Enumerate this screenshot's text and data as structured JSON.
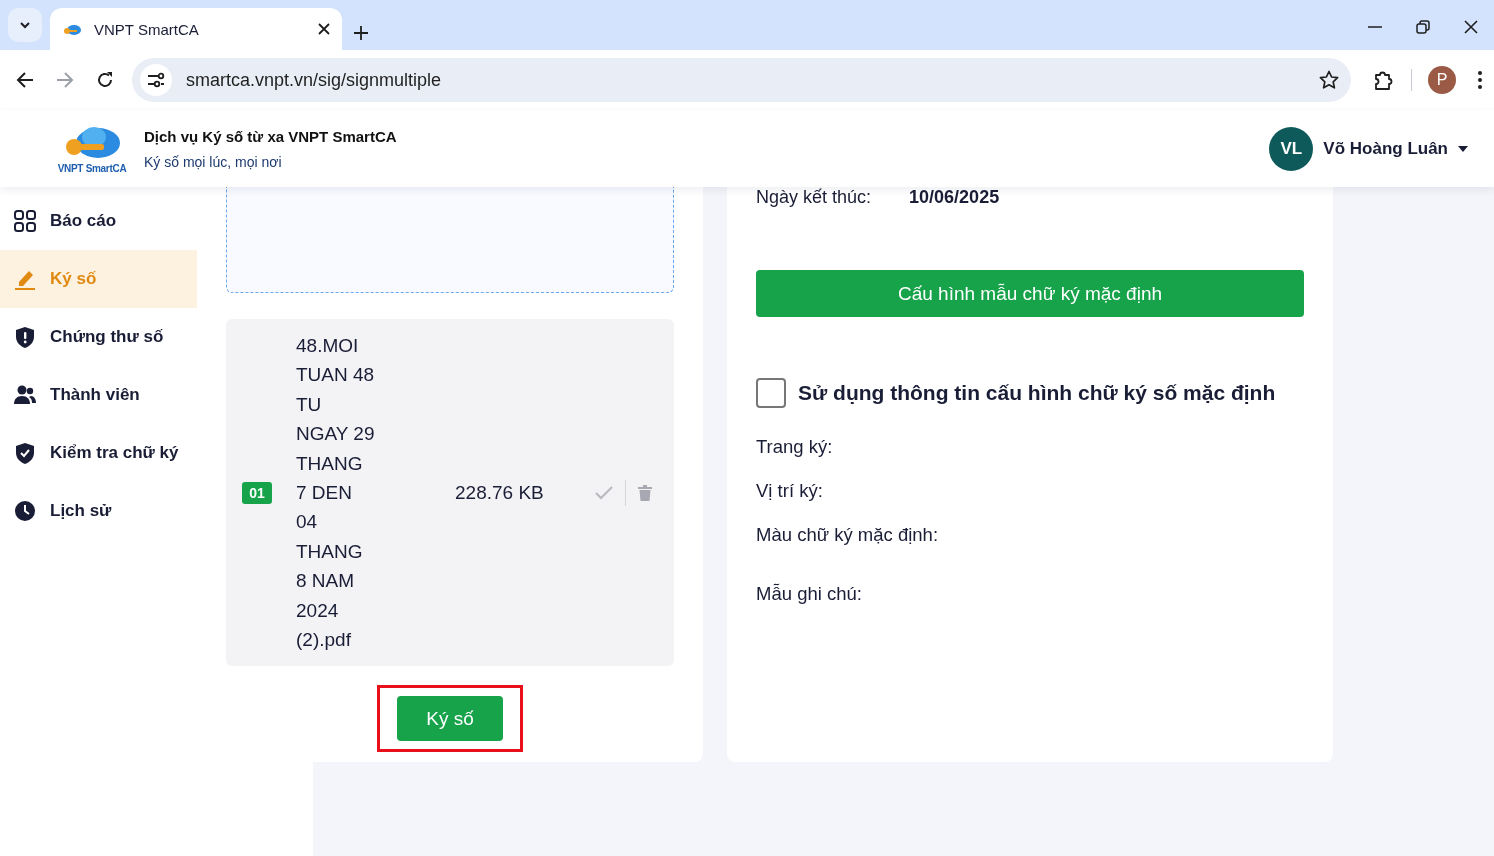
{
  "browser": {
    "tab_title": "VNPT SmartCA",
    "url": "smartca.vnpt.vn/sig/signmultiple",
    "profile_initial": "P"
  },
  "header": {
    "logo_text": "VNPT SmartCA",
    "title": "Dịch vụ Ký số từ xa VNPT SmartCA",
    "subtitle": "Ký số mọi lúc, mọi nơi",
    "user_initials": "VL",
    "user_name": "Võ Hoàng Luân"
  },
  "sidebar": {
    "items": [
      {
        "kind": "grid",
        "label": "Báo cáo",
        "selected": false
      },
      {
        "kind": "pen",
        "label": "Ký số",
        "selected": true
      },
      {
        "kind": "shield-alert",
        "label": "Chứng thư số",
        "selected": false
      },
      {
        "kind": "users",
        "label": "Thành viên",
        "selected": false
      },
      {
        "kind": "shield-check",
        "label": "Kiểm tra chữ ký",
        "selected": false
      },
      {
        "kind": "clock",
        "label": "Lịch sử",
        "selected": false
      }
    ]
  },
  "files": [
    {
      "index": "01",
      "name": "48.MOI TUAN 48 TU NGAY 29 THANG 7 DEN 04 THANG 8 NAM 2024 (2).pdf",
      "size": "228.76 KB"
    }
  ],
  "sign_button": {
    "label": "Ký số",
    "highlighted": true
  },
  "config": {
    "end_date_label": "Ngày kết thúc:",
    "end_date": "10/06/2025",
    "template_button": "Cấu hình mẫu chữ ký mặc định",
    "use_default": {
      "label": "Sử dụng thông tin cấu hình chữ ký số mặc định",
      "checked": false
    },
    "fields": [
      "Trang ký:",
      "Vị trí ký:",
      "Màu chữ ký mặc định:",
      "Mẫu ghi chú:"
    ]
  }
}
